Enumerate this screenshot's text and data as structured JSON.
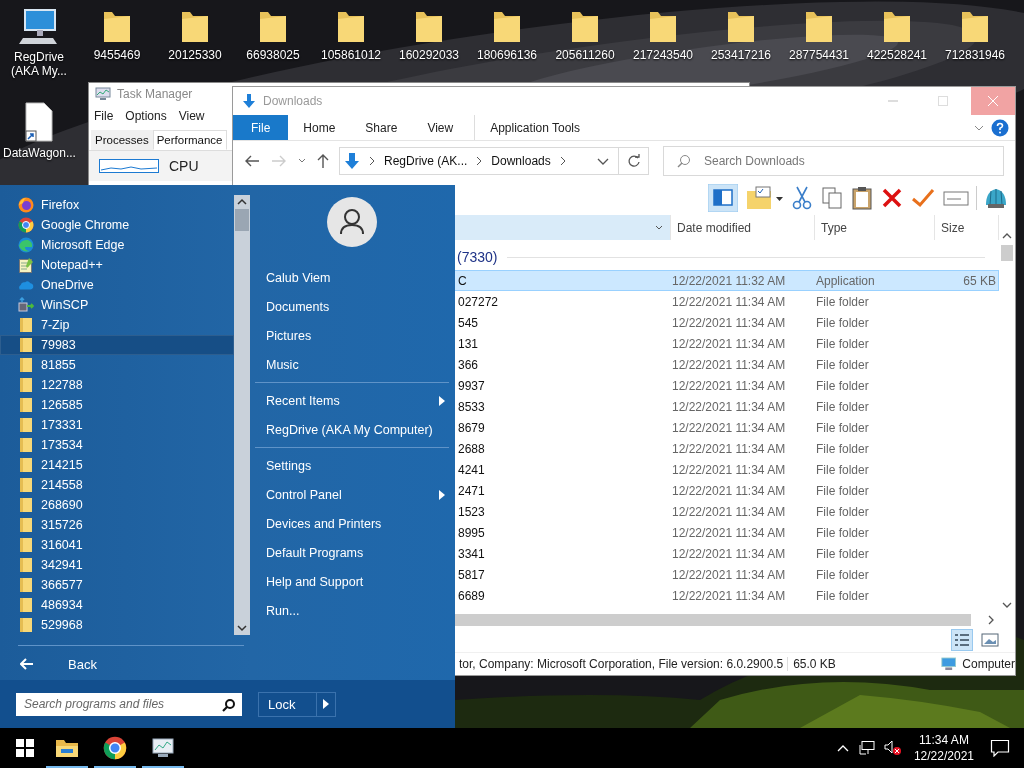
{
  "desktop_icons": [
    {
      "label": "RegDrive (AKA My...",
      "kind": "computer"
    },
    {
      "label": "9455469",
      "kind": "folder"
    },
    {
      "label": "20125330",
      "kind": "folder"
    },
    {
      "label": "66938025",
      "kind": "folder"
    },
    {
      "label": "105861012",
      "kind": "folder"
    },
    {
      "label": "160292033",
      "kind": "folder"
    },
    {
      "label": "180696136",
      "kind": "folder"
    },
    {
      "label": "205611260",
      "kind": "folder"
    },
    {
      "label": "217243540",
      "kind": "folder"
    },
    {
      "label": "253417216",
      "kind": "folder"
    },
    {
      "label": "287754431",
      "kind": "folder"
    },
    {
      "label": "422528241",
      "kind": "folder"
    },
    {
      "label": "712831946",
      "kind": "folder"
    },
    {
      "label": "DataWagon...",
      "kind": "file"
    }
  ],
  "task_manager": {
    "title": "Task Manager",
    "menu": [
      "File",
      "Options",
      "View"
    ],
    "tabs": [
      {
        "label": "Processes",
        "selected": false
      },
      {
        "label": "Performance",
        "selected": true
      }
    ],
    "section": "CPU"
  },
  "explorer": {
    "title": "Downloads",
    "ribbon_tabs": [
      {
        "label": "File",
        "selected": true
      },
      {
        "label": "Home",
        "selected": false
      },
      {
        "label": "Share",
        "selected": false
      },
      {
        "label": "View",
        "selected": false
      },
      {
        "label": "Application Tools",
        "selected": false
      }
    ],
    "path": [
      "RegDrive (AK...",
      "Downloads"
    ],
    "search": {
      "placeholder": "Search Downloads"
    },
    "columns": [
      "Date modified",
      "Type",
      "Size"
    ],
    "group": "(7330)",
    "rows": [
      {
        "name": "C",
        "date": "12/22/2021 11:32 AM",
        "type": "Application",
        "size": "65 KB",
        "selected": true
      },
      {
        "name": "027272",
        "date": "12/22/2021 11:34 AM",
        "type": "File folder",
        "selected": false
      },
      {
        "name": "545",
        "date": "12/22/2021 11:34 AM",
        "type": "File folder",
        "selected": false
      },
      {
        "name": "131",
        "date": "12/22/2021 11:34 AM",
        "type": "File folder",
        "selected": false
      },
      {
        "name": "366",
        "date": "12/22/2021 11:34 AM",
        "type": "File folder",
        "selected": false
      },
      {
        "name": "9937",
        "date": "12/22/2021 11:34 AM",
        "type": "File folder",
        "selected": false
      },
      {
        "name": "8533",
        "date": "12/22/2021 11:34 AM",
        "type": "File folder",
        "selected": false
      },
      {
        "name": "8679",
        "date": "12/22/2021 11:34 AM",
        "type": "File folder",
        "selected": false
      },
      {
        "name": "2688",
        "date": "12/22/2021 11:34 AM",
        "type": "File folder",
        "selected": false
      },
      {
        "name": "4241",
        "date": "12/22/2021 11:34 AM",
        "type": "File folder",
        "selected": false
      },
      {
        "name": "2471",
        "date": "12/22/2021 11:34 AM",
        "type": "File folder",
        "selected": false
      },
      {
        "name": "1523",
        "date": "12/22/2021 11:34 AM",
        "type": "File folder",
        "selected": false
      },
      {
        "name": "8995",
        "date": "12/22/2021 11:34 AM",
        "type": "File folder",
        "selected": false
      },
      {
        "name": "3341",
        "date": "12/22/2021 11:34 AM",
        "type": "File folder",
        "selected": false
      },
      {
        "name": "5817",
        "date": "12/22/2021 11:34 AM",
        "type": "File folder",
        "selected": false
      },
      {
        "name": "6689",
        "date": "12/22/2021 11:34 AM",
        "type": "File folder",
        "selected": false
      }
    ],
    "status": {
      "details": "tor, Company: Microsoft Corporation, File version: 6.0.2900.5",
      "size": "65.0 KB",
      "location": "Computer"
    }
  },
  "start_menu": {
    "programs": [
      {
        "label": "Firefox",
        "kind": "firefox",
        "selected": false
      },
      {
        "label": "Google Chrome",
        "kind": "chrome",
        "selected": false
      },
      {
        "label": "Microsoft Edge",
        "kind": "edge",
        "selected": false
      },
      {
        "label": "Notepad++",
        "kind": "notepad",
        "selected": false
      },
      {
        "label": "OneDrive",
        "kind": "onedrive",
        "selected": false
      },
      {
        "label": "WinSCP",
        "kind": "winscp",
        "selected": false
      },
      {
        "label": "7-Zip",
        "kind": "folder",
        "selected": false
      },
      {
        "label": "79983",
        "kind": "folder",
        "selected": true
      },
      {
        "label": "81855",
        "kind": "folder",
        "selected": false
      },
      {
        "label": "122788",
        "kind": "folder",
        "selected": false
      },
      {
        "label": "126585",
        "kind": "folder",
        "selected": false
      },
      {
        "label": "173331",
        "kind": "folder",
        "selected": false
      },
      {
        "label": "173534",
        "kind": "folder",
        "selected": false
      },
      {
        "label": "214215",
        "kind": "folder",
        "selected": false
      },
      {
        "label": "214558",
        "kind": "folder",
        "selected": false
      },
      {
        "label": "268690",
        "kind": "folder",
        "selected": false
      },
      {
        "label": "315726",
        "kind": "folder",
        "selected": false
      },
      {
        "label": "316041",
        "kind": "folder",
        "selected": false
      },
      {
        "label": "342941",
        "kind": "folder",
        "selected": false
      },
      {
        "label": "366577",
        "kind": "folder",
        "selected": false
      },
      {
        "label": "486934",
        "kind": "folder",
        "selected": false
      },
      {
        "label": "529968",
        "kind": "folder",
        "selected": false
      }
    ],
    "back": "Back",
    "search": {
      "placeholder": "Search programs and files"
    },
    "place_groups": [
      [
        {
          "label": "Calub Viem",
          "submenu": false
        },
        {
          "label": "Documents",
          "submenu": false
        },
        {
          "label": "Pictures",
          "submenu": false
        },
        {
          "label": "Music",
          "submenu": false
        }
      ],
      [
        {
          "label": "Recent Items",
          "submenu": true
        },
        {
          "label": "RegDrive (AKA My Computer)",
          "submenu": false
        }
      ],
      [
        {
          "label": "Settings",
          "submenu": false
        },
        {
          "label": "Control Panel",
          "submenu": true
        },
        {
          "label": "Devices and Printers",
          "submenu": false
        },
        {
          "label": "Default Programs",
          "submenu": false
        },
        {
          "label": "Help and Support",
          "submenu": false
        },
        {
          "label": "Run...",
          "submenu": false
        }
      ]
    ],
    "lock": "Lock"
  },
  "taskbar": {
    "apps": [
      {
        "kind": "explorer",
        "running": true
      },
      {
        "kind": "chrome",
        "running": true
      },
      {
        "kind": "taskmanager",
        "running": true
      }
    ],
    "time": "11:34 AM",
    "date": "12/22/2021"
  }
}
